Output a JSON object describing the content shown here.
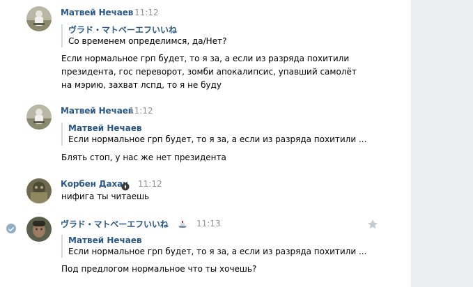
{
  "messages": [
    {
      "author": "Матвей Нечаев",
      "time": "11:12",
      "quote": {
        "author": "ヴラド・マトベーエフいいね",
        "text": "Со временем определимся, да/Нет?"
      },
      "lines": [
        "Если нормальное грп будет, то я за, а если из разряда похитили",
        "президента, гос переворот, зомби апокалипсис, упавший самолёт",
        "на мэрию, захват лспд, то я не буду"
      ]
    },
    {
      "author": "Матвей Нечаев",
      "time": "11:12",
      "quote": {
        "author": "Матвей Нечаев",
        "text": "Если нормальное грп будет, то я за, а если из разряда похитили ..."
      },
      "lines": [
        "Блять стоп, у нас же нет президента"
      ]
    },
    {
      "author": "Корбен Дахак",
      "time": "11:12",
      "lines": [
        "нифига ты читаешь"
      ]
    },
    {
      "author": "ヴラド・マトベーエフいいね",
      "time": "11:13",
      "quote": {
        "author": "Матвей Нечаев",
        "text": "Если нормальное грп будет, то я за, а если из разряда похитили ..."
      },
      "lines": [
        "Под предлогом нормальное что ты хочешь?"
      ]
    }
  ],
  "icons": {
    "author_badge": "verified-badge-icon",
    "emoji_badge": "ship-emoji-icon",
    "selected": "check-icon",
    "favorite": "star-icon"
  },
  "colors": {
    "author": "#2a5885",
    "time": "#939393",
    "quote_bar": "#d3d9de",
    "side_panel": "#edeef0"
  }
}
